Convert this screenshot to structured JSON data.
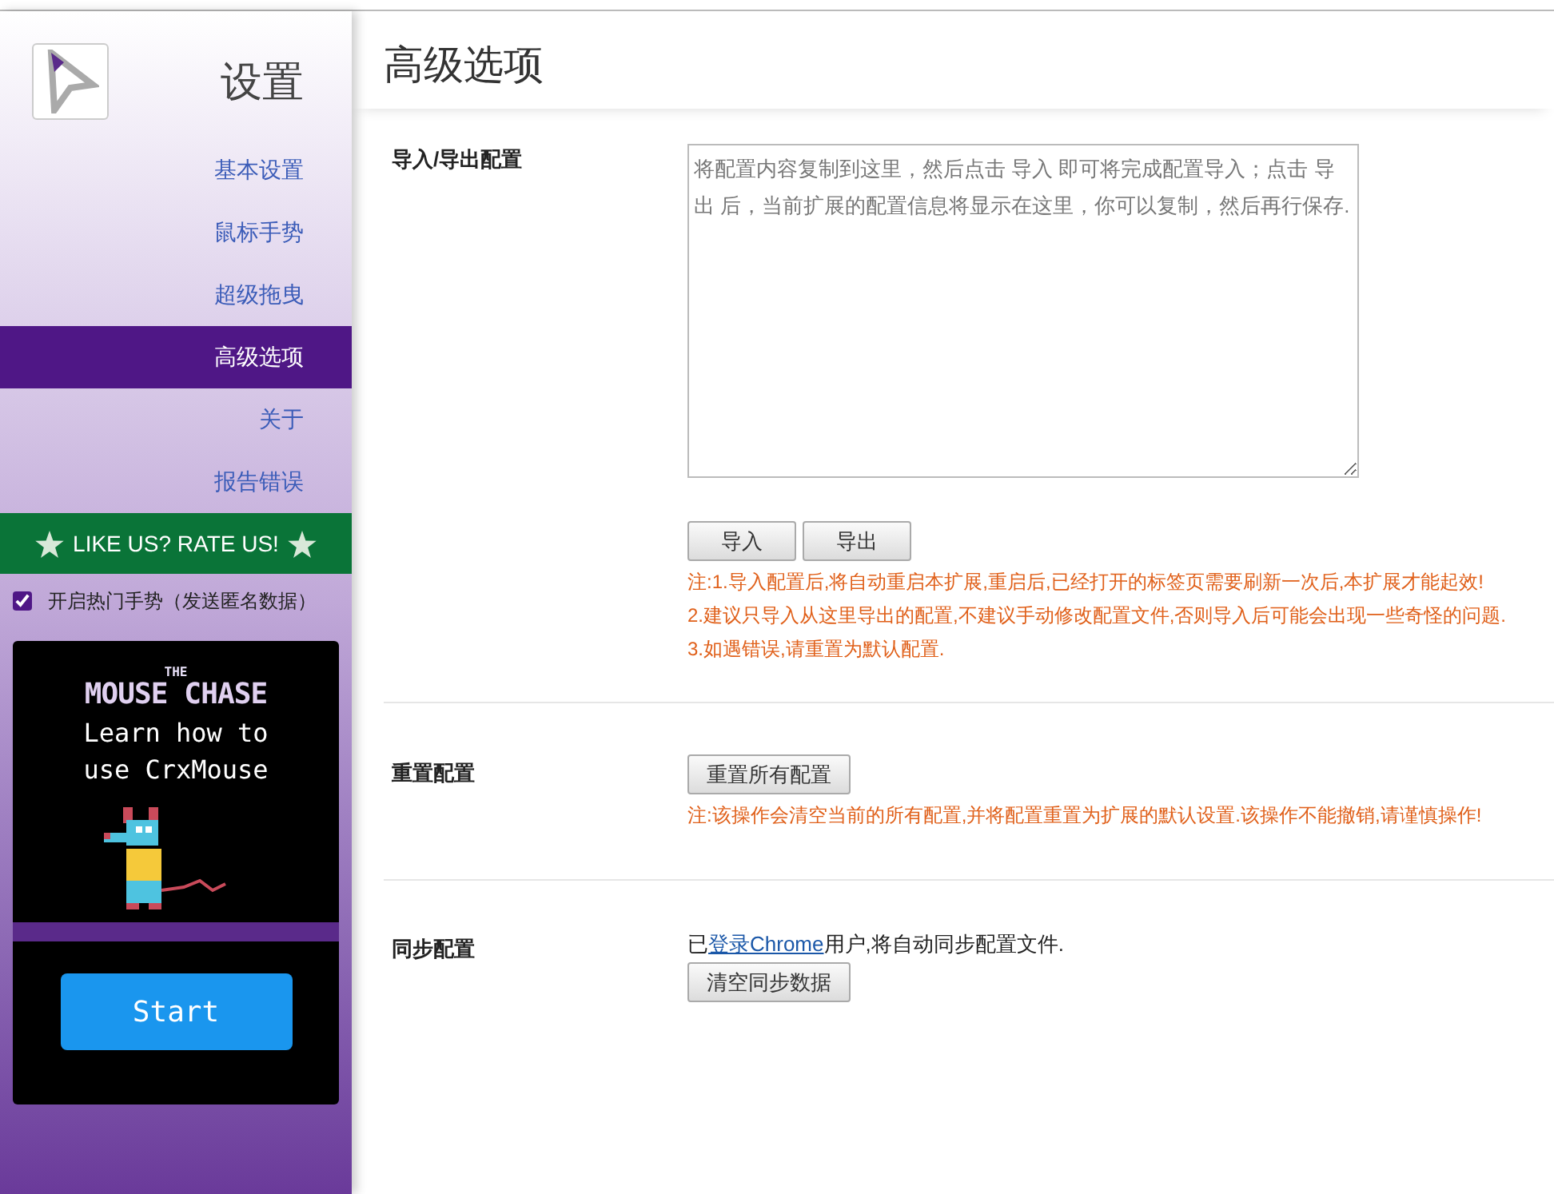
{
  "sidebar": {
    "title": "设置",
    "items": [
      {
        "label": "基本设置",
        "selected": false
      },
      {
        "label": "鼠标手势",
        "selected": false
      },
      {
        "label": "超级拖曳",
        "selected": false
      },
      {
        "label": "高级选项",
        "selected": true
      },
      {
        "label": "关于",
        "selected": false
      },
      {
        "label": "报告错误",
        "selected": false
      }
    ],
    "rate_banner": "LIKE US? RATE US!",
    "hot_gestures": {
      "label": "开启热门手势（发送匿名数据）",
      "checked": true
    },
    "ad": {
      "logo_small": "THE",
      "logo": "MOUSE CHASE",
      "text": "Learn how to use CrxMouse",
      "button": "Start"
    }
  },
  "page_title": "高级选项",
  "sections": [
    {
      "kind": "import_export",
      "label": "导入/导出配置",
      "placeholder": "将配置内容复制到这里，然后点击 导入 即可将完成配置导入；点击 导出 后，当前扩展的配置信息将显示在这里，你可以复制，然后再行保存.",
      "buttons": [
        "导入",
        "导出"
      ],
      "notes": [
        "注:1.导入配置后,将自动重启本扩展,重启后,已经打开的标签页需要刷新一次后,本扩展才能起效!",
        "2.建议只导入从这里导出的配置,不建议手动修改配置文件,否则导入后可能会出现一些奇怪的问题.",
        "3.如遇错误,请重置为默认配置."
      ]
    },
    {
      "kind": "reset",
      "label": "重置配置",
      "buttons": [
        "重置所有配置"
      ],
      "notes": [
        "注:该操作会清空当前的所有配置,并将配置重置为扩展的默认设置.该操作不能撤销,请谨慎操作!"
      ]
    },
    {
      "kind": "sync",
      "label": "同步配置",
      "text_before": "已",
      "link": "登录Chrome",
      "text_after": "用户,将自动同步配置文件.",
      "buttons": [
        "清空同步数据"
      ]
    }
  ]
}
